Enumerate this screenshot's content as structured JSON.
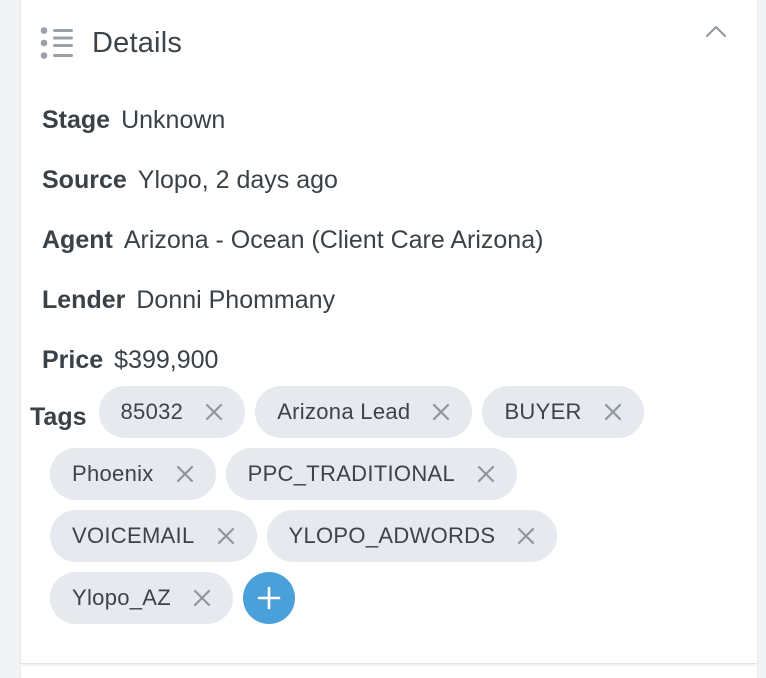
{
  "section": {
    "title": "Details"
  },
  "fields": [
    {
      "label": "Stage",
      "value": "Unknown"
    },
    {
      "label": "Source",
      "value": "Ylopo, 2 days ago"
    },
    {
      "label": "Agent",
      "value": "Arizona - Ocean (Client Care Arizona)"
    },
    {
      "label": "Lender",
      "value": "Donni Phommany"
    },
    {
      "label": "Price",
      "value": "$399,900"
    }
  ],
  "tags": {
    "label": "Tags",
    "items": [
      "85032",
      "Arizona Lead",
      "BUYER",
      "Phoenix",
      "PPC_TRADITIONAL",
      "VOICEMAIL",
      "YLOPO_ADWORDS",
      "Ylopo_AZ"
    ]
  },
  "icons": {
    "header": "list-icon",
    "collapse": "chevron-up-icon",
    "remove_tag": "close-icon",
    "add_tag": "plus-icon"
  },
  "colors": {
    "tag_background": "#e6e9ed",
    "add_button": "#4aa0d9",
    "text": "#3a4147",
    "icon_gray": "#8f969c"
  }
}
